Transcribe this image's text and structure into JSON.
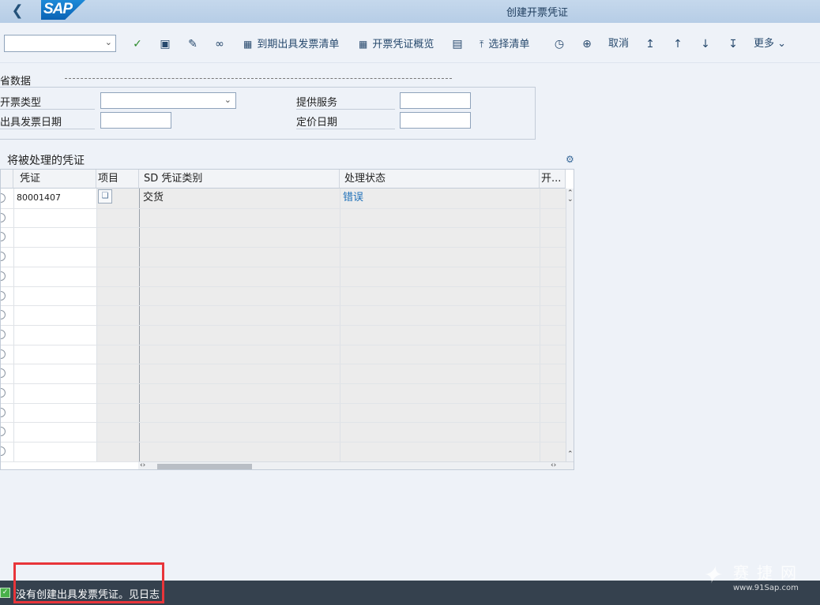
{
  "window": {
    "title": "创建开票凭证",
    "logo": "SAP"
  },
  "toolbar": {
    "command_value": "",
    "items": {
      "due_list": "到期出具发票清单",
      "overview": "开票凭证概览",
      "selection_list": "选择清单",
      "cancel": "取消",
      "more": "更多"
    }
  },
  "defaults": {
    "title": "省数据",
    "fields": {
      "billing_type_label": "开票类型",
      "billing_type_value": "",
      "billing_date_label": "出具发票日期",
      "billing_date_value": "",
      "services_label": "提供服务",
      "services_value": "",
      "pricing_date_label": "定价日期",
      "pricing_date_value": ""
    }
  },
  "table": {
    "title": "将被处理的凭证",
    "columns": [
      "凭证",
      "项目",
      "SD 凭证类别",
      "处理状态",
      "开..."
    ],
    "rows": [
      {
        "document": "80001407",
        "item": "",
        "category": "交货",
        "status": "错误"
      }
    ]
  },
  "status": {
    "message": "没有创建出具发票凭证。见日志"
  },
  "watermark": {
    "text": "赛捷网",
    "url": "www.91Sap.com"
  }
}
